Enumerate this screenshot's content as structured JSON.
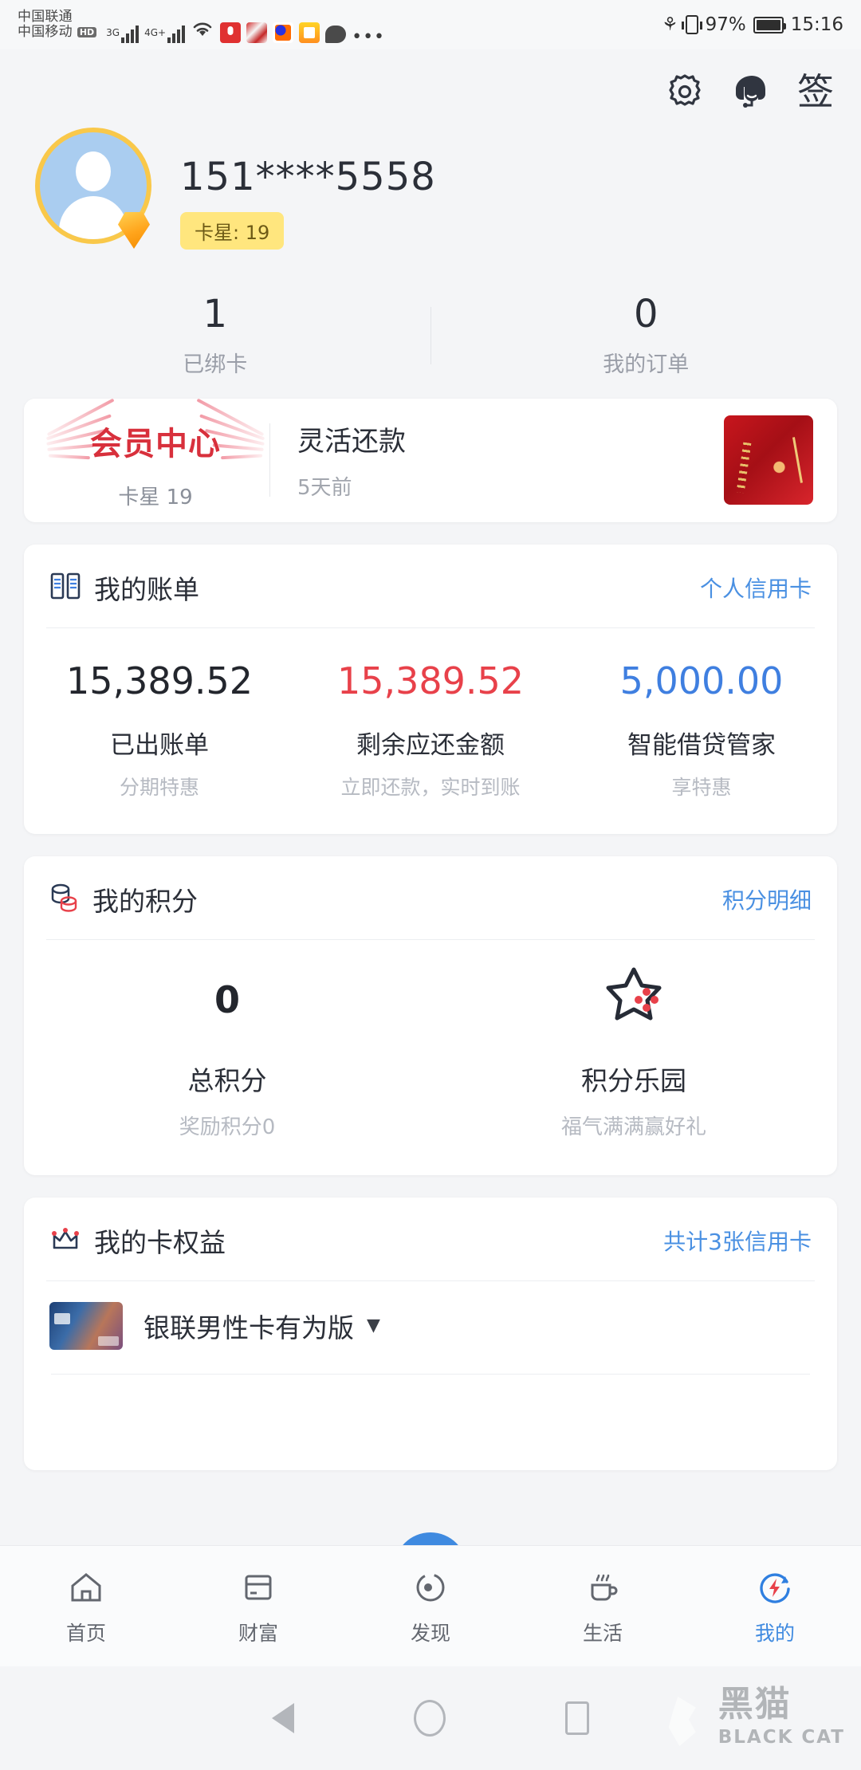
{
  "status_bar": {
    "carrier_primary": "中国联通",
    "carrier_secondary": "中国移动",
    "hd_label": "HD",
    "network_1": "3G",
    "network_2": "4G+",
    "battery_percent": "97%",
    "time": "15:16",
    "more_dots": "•••"
  },
  "header": {
    "settings_icon": "gear-icon",
    "service_icon": "customer-service-icon",
    "sign_label": "签"
  },
  "profile": {
    "phone_masked": "151****5558",
    "star_badge": "卡星: 19",
    "avatar_icon": "user-avatar",
    "gem_icon": "diamond-badge"
  },
  "stats": [
    {
      "value": "1",
      "label": "已绑卡"
    },
    {
      "value": "0",
      "label": "我的订单"
    }
  ],
  "member_banner": {
    "vip_title": "会员中心",
    "vip_sub": "卡星 19",
    "item_title": "灵活还款",
    "item_time": "5天前",
    "thumb_icon": "promo-thumbnail"
  },
  "bill_card": {
    "title": "我的账单",
    "icon": "bill-book-icon",
    "link": "个人信用卡",
    "items": [
      {
        "amount": "15,389.52",
        "name": "已出账单",
        "sub": "分期特惠",
        "color": "#23262d"
      },
      {
        "amount": "15,389.52",
        "name": "剩余应还金额",
        "sub": "立即还款，实时到账",
        "color": "#e8414a"
      },
      {
        "amount": "5,000.00",
        "name": "智能借贷管家",
        "sub": "享特惠",
        "color": "#3f7fe0"
      }
    ]
  },
  "points_card": {
    "title": "我的积分",
    "icon": "coins-icon",
    "link": "积分明细",
    "total_value": "0",
    "total_name": "总积分",
    "total_sub": "奖励积分0",
    "park_icon": "star-park-icon",
    "park_name": "积分乐园",
    "park_sub": "福气满满赢好礼"
  },
  "rights_card": {
    "title": "我的卡权益",
    "icon": "crown-icon",
    "link": "共计3张信用卡",
    "card_name": "银联男性卡有为版",
    "caret": "▼",
    "card_thumb_icon": "credit-card-thumbnail"
  },
  "tabbar": {
    "items": [
      {
        "label": "首页",
        "icon": "home-icon",
        "active": false
      },
      {
        "label": "财富",
        "icon": "wallet-card-icon",
        "active": false
      },
      {
        "label": "发现",
        "icon": "compass-icon",
        "active": false
      },
      {
        "label": "生活",
        "icon": "coffee-cup-icon",
        "active": false
      },
      {
        "label": "我的",
        "icon": "profile-bolt-icon",
        "active": true
      }
    ]
  },
  "android_nav": {
    "back_icon": "back-triangle-icon",
    "home_icon": "home-circle-icon",
    "recents_icon": "recents-square-icon"
  },
  "watermark": {
    "cn": "黑猫",
    "en": "BLACK CAT"
  },
  "colors": {
    "accent_blue": "#3f8ae0",
    "link_blue": "#4a90e2",
    "alert_red": "#e8414a",
    "vip_red": "#d8303c",
    "badge_yellow": "#ffe67e",
    "page_bg": "#f4f5f7"
  }
}
